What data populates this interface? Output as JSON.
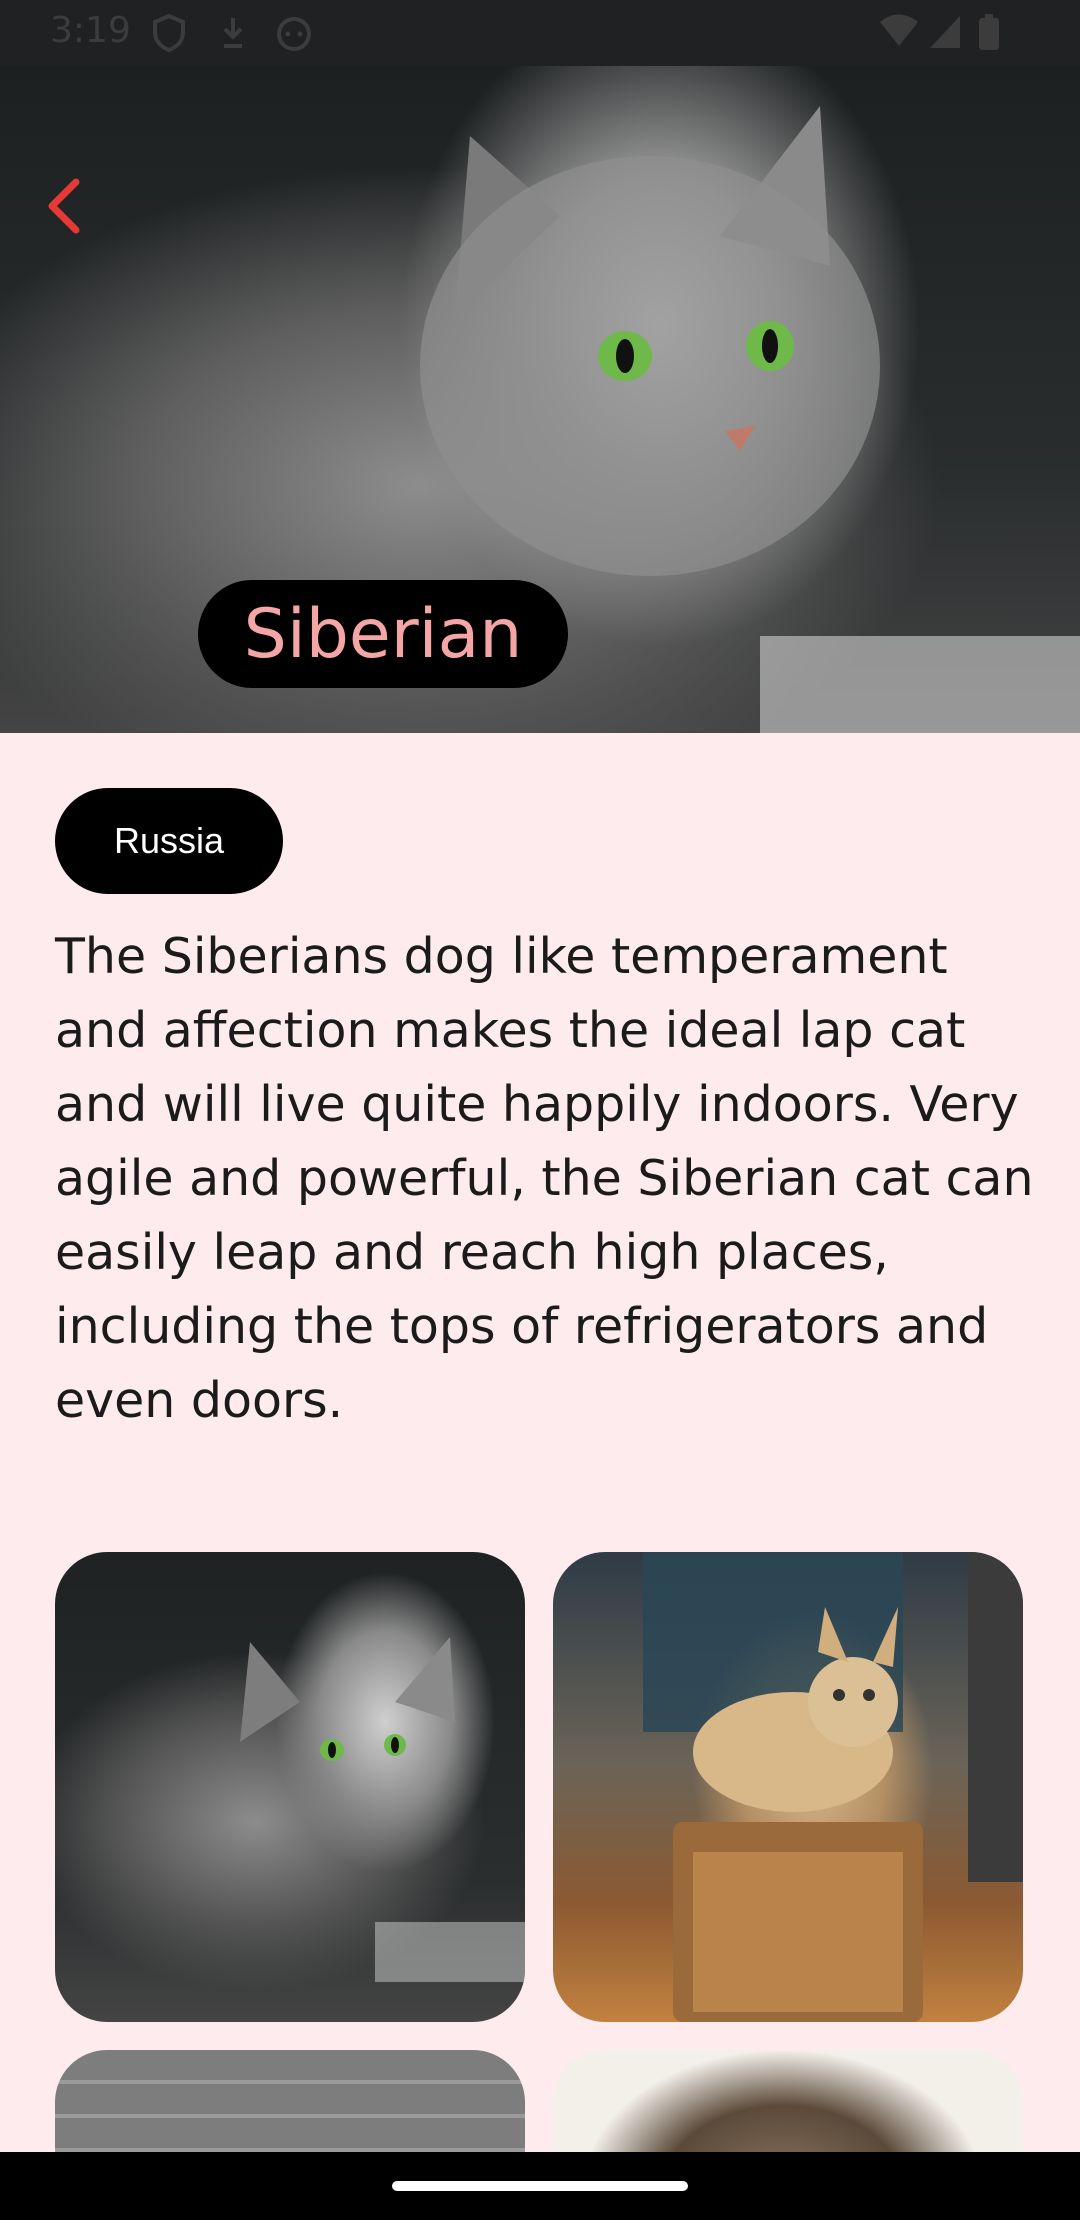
{
  "status_bar": {
    "time": "3:19",
    "icons": [
      "shield-icon",
      "download-icon",
      "cat-face-icon",
      "wifi-icon",
      "signal-icon",
      "battery-icon"
    ]
  },
  "hero": {
    "image": "siberian-cat-photo",
    "back_icon": "chevron-left-icon",
    "back_color": "#e53935",
    "title": "Siberian",
    "title_color": "#f4a6a6"
  },
  "origin": "Russia",
  "description": "The Siberians dog like temperament and affection makes the ideal lap cat and will live quite happily indoors. Very agile and powerful, the Siberian cat can easily leap and reach high places, including the tops of refrigerators and even doors.",
  "gallery": [
    {
      "image": "siberian-cat-photo"
    },
    {
      "image": "tan-cat-on-amplifier-photo"
    },
    {
      "image": "brick-wall-photo"
    },
    {
      "image": "tabby-cat-photo"
    }
  ],
  "colors": {
    "background": "#fdebee",
    "accent": "#e53935"
  }
}
